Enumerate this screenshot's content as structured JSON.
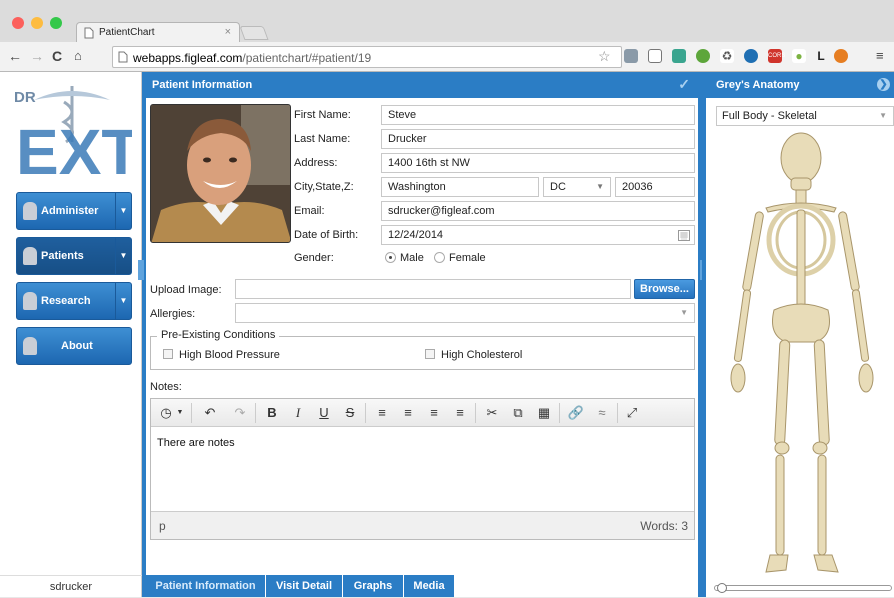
{
  "browser": {
    "tab_title": "PatientChart",
    "tab_close": "×",
    "url_host": "webapps.figleaf.com",
    "url_path": "/patientchart/#patient/19",
    "ext_cors": "CORS",
    "ext_l": "L"
  },
  "sidebar": {
    "items": [
      {
        "label": "Administer"
      },
      {
        "label": "Patients"
      },
      {
        "label": "Research"
      },
      {
        "label": "About"
      }
    ],
    "username": "sdrucker"
  },
  "patient_panel": {
    "title": "Patient Information",
    "labels": {
      "first_name": "First Name:",
      "last_name": "Last Name:",
      "address": "Address:",
      "city_state_zip": "City,State,Z:",
      "email": "Email:",
      "dob": "Date of Birth:",
      "gender": "Gender:",
      "upload": "Upload Image:",
      "allergies": "Allergies:",
      "notes": "Notes:"
    },
    "values": {
      "first_name": "Steve",
      "last_name": "Drucker",
      "address": "1400 16th st NW",
      "city": "Washington",
      "state": "DC",
      "zip": "20036",
      "email": "sdrucker@figleaf.com",
      "dob": "12/24/2014",
      "gender_male": "Male",
      "gender_female": "Female",
      "gender_selected": "Male"
    },
    "browse_label": "Browse...",
    "conditions_legend": "Pre-Existing Conditions",
    "conditions": [
      "High Blood Pressure",
      "High Cholesterol"
    ],
    "editor": {
      "content": "There are notes",
      "status_tag": "p",
      "word_count": "Words: 3"
    },
    "bottom_tabs": [
      "Patient Information",
      "Visit Detail",
      "Graphs",
      "Media"
    ]
  },
  "anatomy_panel": {
    "title": "Grey's Anatomy",
    "selected_view": "Full Body - Skeletal"
  },
  "colors": {
    "primary": "#2b7dc5",
    "nav_button": "#2672bd"
  }
}
